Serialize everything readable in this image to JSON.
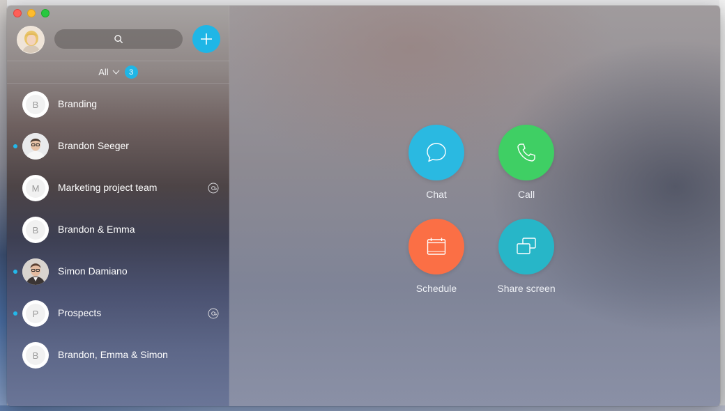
{
  "window": {
    "traffic_lights": [
      "close",
      "minimize",
      "zoom"
    ]
  },
  "header": {
    "avatar_icon": "user-avatar-photo",
    "search_icon": "search-icon",
    "add_icon": "plus-icon"
  },
  "filter": {
    "label": "All",
    "chevron_icon": "chevron-down-icon",
    "badge": "3"
  },
  "conversations": [
    {
      "name": "Branding",
      "initial": "B",
      "unread": false,
      "mention": false,
      "photo": false
    },
    {
      "name": "Brandon Seeger",
      "initial": "",
      "unread": true,
      "mention": false,
      "photo": true
    },
    {
      "name": "Marketing project team",
      "initial": "M",
      "unread": false,
      "mention": true,
      "photo": false
    },
    {
      "name": "Brandon & Emma",
      "initial": "B",
      "unread": false,
      "mention": false,
      "photo": false
    },
    {
      "name": "Simon Damiano",
      "initial": "",
      "unread": true,
      "mention": false,
      "photo": true
    },
    {
      "name": "Prospects",
      "initial": "P",
      "unread": true,
      "mention": true,
      "photo": false
    },
    {
      "name": "Brandon, Emma & Simon",
      "initial": "B",
      "unread": false,
      "mention": false,
      "photo": false
    }
  ],
  "actions": {
    "chat": {
      "label": "Chat",
      "color": "#2ab9e1",
      "icon": "chat-bubble-icon"
    },
    "call": {
      "label": "Call",
      "color": "#3fcf64",
      "icon": "phone-icon"
    },
    "schedule": {
      "label": "Schedule",
      "color": "#fb6f45",
      "icon": "calendar-icon"
    },
    "share": {
      "label": "Share screen",
      "color": "#27b6c8",
      "icon": "share-screen-icon"
    }
  },
  "colors": {
    "accent": "#1fb6e6",
    "unread_dot": "#23b8ea"
  }
}
